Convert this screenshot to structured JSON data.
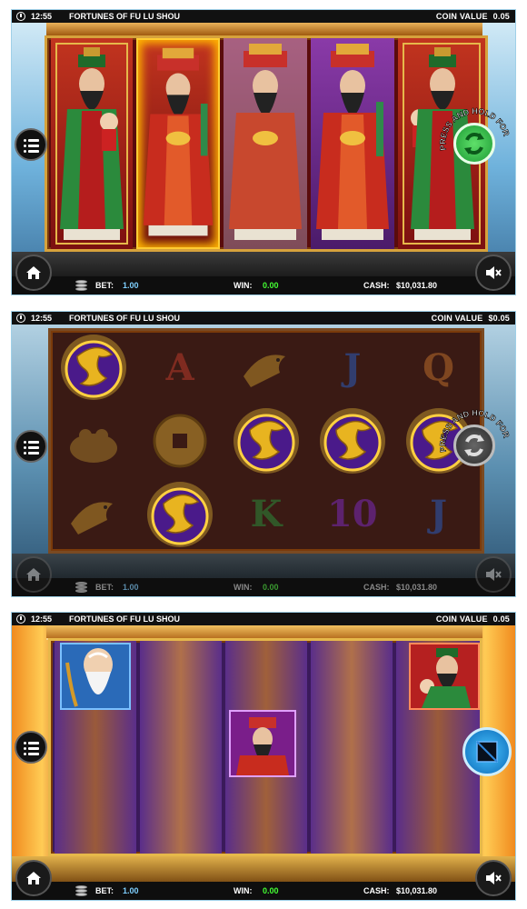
{
  "status_bar": {
    "time": "12:55",
    "game_title": "FORTUNES OF FU LU SHOU",
    "coin_value_label": "COIN VALUE"
  },
  "screens": [
    {
      "coin_value": "0.05",
      "bet_label": "BET:",
      "bet_value": "1.00",
      "win_label": "WIN:",
      "win_value": "0.00",
      "cash_label": "CASH:",
      "cash_value": "$10,031.80",
      "autoplay_text": "PRESS AND HOLD FOR AUTOPLAY",
      "reels": [
        "Fu (red-green robe, holding child)",
        "Lu (wild, glowing frame)",
        "Lu (purple background)",
        "Lu (purple background)",
        "Fu (red-green robe, holding child)"
      ]
    },
    {
      "coin_value": "$0.05",
      "bet_label": "BET:",
      "bet_value": "1.00",
      "win_label": "WIN:",
      "win_value": "0.00",
      "cash_label": "CASH:",
      "cash_value": "$10,031.80",
      "autoplay_text": "PRESS AND HOLD FOR AUTOPLAY",
      "grid": [
        [
          "dragon",
          "A",
          "koi",
          "J",
          "Q"
        ],
        [
          "toad",
          "coin",
          "dragon",
          "dragon",
          "dragon"
        ],
        [
          "koi",
          "dragon",
          "K",
          "10",
          "J"
        ]
      ]
    },
    {
      "coin_value": "0.05",
      "bet_label": "BET:",
      "bet_value": "1.00",
      "win_label": "WIN:",
      "win_value": "0.00",
      "cash_label": "CASH:",
      "cash_value": "$10,031.80",
      "symbols_landed": [
        "Shou (elder with white beard)",
        "Lu (red frame)",
        "Fu (holding child)"
      ]
    }
  ],
  "colors": {
    "win_green": "#44ff33",
    "bet_blue": "#7fd0ff",
    "autoplay_green": "#2db84a",
    "stop_blue": "#1ea0ff",
    "gold": "#d6a23c"
  },
  "icons": [
    "clock-icon",
    "home-icon",
    "menu-icon",
    "mute-icon",
    "coin-stack-icon",
    "autoplay-icon",
    "stop-icon"
  ]
}
